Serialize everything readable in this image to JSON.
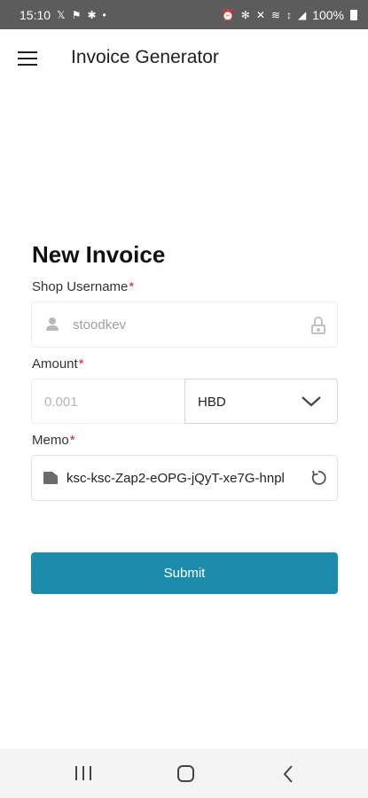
{
  "status_bar": {
    "time": "15:10",
    "left_icons": [
      "x-icon",
      "signal-app-icon",
      "gear-icon",
      "dot-icon"
    ],
    "right_icons": [
      "alarm-icon",
      "bluetooth-icon",
      "mute-icon",
      "wifi-icon",
      "lte-icon",
      "signal-icon"
    ],
    "battery": "100%"
  },
  "app_bar": {
    "title": "Invoice Generator"
  },
  "form": {
    "heading": "New Invoice",
    "shop_username": {
      "label": "Shop Username",
      "required_mark": "*",
      "value": "stoodkev"
    },
    "amount": {
      "label": "Amount",
      "required_mark": "*",
      "placeholder": "0.001",
      "currency": "HBD"
    },
    "memo": {
      "label": "Memo",
      "required_mark": "*",
      "value": "ksc-ksc-Zap2-eOPG-jQyT-xe7G-hnpl"
    },
    "submit_label": "Submit"
  },
  "colors": {
    "status_bar": "#5c5c5c",
    "accent": "#1d8bac",
    "required": "#c62828"
  }
}
